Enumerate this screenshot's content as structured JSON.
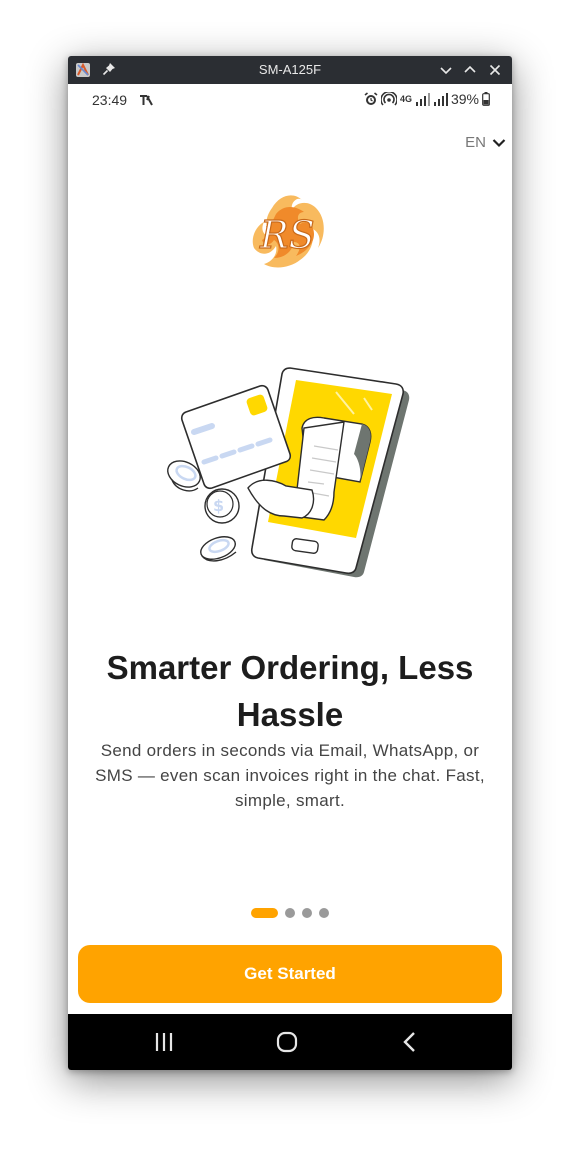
{
  "window": {
    "title": "SM-A125F"
  },
  "status_bar": {
    "time": "23:49",
    "network": "4G",
    "battery": "39%"
  },
  "language": {
    "selected": "EN"
  },
  "onboarding": {
    "headline": "Smarter Ordering, Less Hassle",
    "description": "Send orders in seconds via Email, WhatsApp, or SMS — even scan invoices right in the chat. Fast, simple, smart.",
    "pages_total": 4,
    "current_page": 1
  },
  "cta": {
    "label": "Get Started"
  },
  "colors": {
    "accent": "#FFA300",
    "illustration_yellow": "#FFD800",
    "card_blue": "#C9D8F2",
    "dot_inactive": "#9A9A9A",
    "logo_orange": "#F0892A"
  },
  "icons": {
    "titlebar": [
      "app-icon",
      "pin-icon",
      "minimize-icon",
      "maximize-icon",
      "close-icon"
    ],
    "status": [
      "tiktok-icon",
      "alarm-icon",
      "hotspot-icon",
      "signal-icon",
      "battery-icon"
    ],
    "nav": [
      "recents-icon",
      "home-icon",
      "back-icon"
    ]
  }
}
